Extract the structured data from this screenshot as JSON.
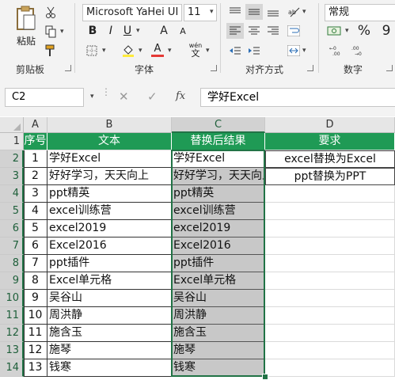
{
  "ribbon": {
    "clipboard": {
      "paste_label": "粘贴",
      "group_label": "剪贴板"
    },
    "font": {
      "font_name": "Microsoft YaHei UI",
      "font_size": "11",
      "bold": "B",
      "italic": "I",
      "underline": "U",
      "grow": "A",
      "shrink": "A",
      "wen": "wén",
      "wen2": "文",
      "group_label": "字体",
      "font_color": "#e53935",
      "fill_color": "#ffeb3b"
    },
    "alignment": {
      "group_label": "对齐方式"
    },
    "number": {
      "format": "常规",
      "percent": "%",
      "comma": "9",
      "group_label": "数字"
    }
  },
  "formula_bar": {
    "name_box": "C2",
    "fx": "fx",
    "content": "学好Excel"
  },
  "columns": [
    "A",
    "B",
    "C",
    "D"
  ],
  "rows": [
    "1",
    "2",
    "3",
    "4",
    "5",
    "6",
    "7",
    "8",
    "9",
    "10",
    "11",
    "12",
    "13",
    "14"
  ],
  "header_row": [
    "序号",
    "文本",
    "替换后结果",
    "要求"
  ],
  "data_rows": [
    {
      "a": "1",
      "b": "学好Excel",
      "c": "学好Excel",
      "d": "excel替换为Excel"
    },
    {
      "a": "2",
      "b": "好好学习，天天向上",
      "c": "好好学习，天天向上",
      "d": "ppt替换为PPT"
    },
    {
      "a": "3",
      "b": "ppt精英",
      "c": "ppt精英",
      "d": ""
    },
    {
      "a": "4",
      "b": "excel训练营",
      "c": "excel训练营",
      "d": ""
    },
    {
      "a": "5",
      "b": "excel2019",
      "c": "excel2019",
      "d": ""
    },
    {
      "a": "6",
      "b": "Excel2016",
      "c": "Excel2016",
      "d": ""
    },
    {
      "a": "7",
      "b": "ppt插件",
      "c": "ppt插件",
      "d": ""
    },
    {
      "a": "8",
      "b": "Excel单元格",
      "c": "Excel单元格",
      "d": ""
    },
    {
      "a": "9",
      "b": "吴谷山",
      "c": "吴谷山",
      "d": ""
    },
    {
      "a": "10",
      "b": "周洪静",
      "c": "周洪静",
      "d": ""
    },
    {
      "a": "11",
      "b": "施含玉",
      "c": "施含玉",
      "d": ""
    },
    {
      "a": "12",
      "b": "施琴",
      "c": "施琴",
      "d": ""
    },
    {
      "a": "13",
      "b": "钱寒",
      "c": "钱寒",
      "d": ""
    }
  ],
  "colors": {
    "header_green": "#1f9a55",
    "selection_green": "#217346",
    "gray_fill": "#c8c8c8"
  }
}
